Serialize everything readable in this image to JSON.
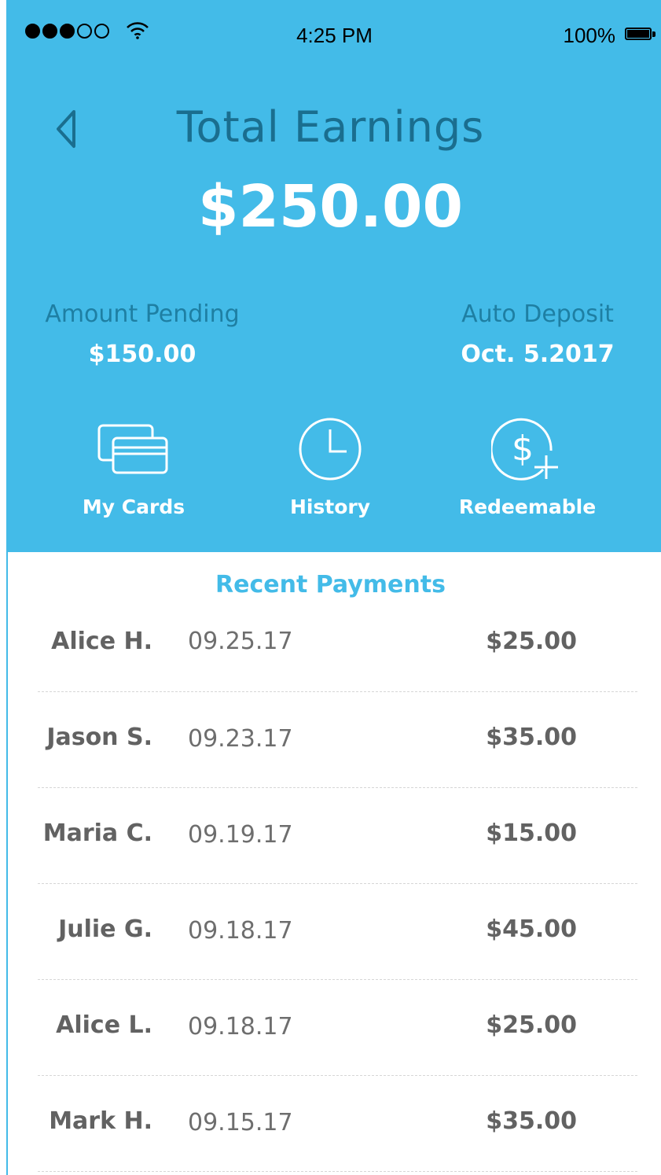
{
  "status_bar": {
    "time": "4:25 PM",
    "battery": "100%",
    "signal_icon": "signal-dots-icon",
    "wifi_icon": "wifi-icon",
    "battery_icon": "battery-icon"
  },
  "header": {
    "back_icon": "back-arrow-icon",
    "title": "Total Earnings",
    "total": "$250.00",
    "pending": {
      "label": "Amount Pending",
      "value": "$150.00"
    },
    "deposit": {
      "label": "Auto Deposit",
      "value": "Oct. 5.2017"
    },
    "actions": [
      {
        "label": "My Cards",
        "icon": "cards-icon"
      },
      {
        "label": "History",
        "icon": "clock-icon"
      },
      {
        "label": "Redeemable",
        "icon": "dollar-plus-icon"
      }
    ]
  },
  "recent": {
    "title": "Recent Payments",
    "payments": [
      {
        "name": "Alice H.",
        "date": "09.25.17",
        "amount": "$25.00"
      },
      {
        "name": "Jason S.",
        "date": "09.23.17",
        "amount": "$35.00"
      },
      {
        "name": "Maria C.",
        "date": "09.19.17",
        "amount": "$15.00"
      },
      {
        "name": "Julie G.",
        "date": "09.18.17",
        "amount": "$45.00"
      },
      {
        "name": "Alice L.",
        "date": "09.18.17",
        "amount": "$25.00"
      },
      {
        "name": "Mark H.",
        "date": "09.15.17",
        "amount": "$35.00"
      }
    ]
  },
  "colors": {
    "header_bg": "#43bbe8",
    "title_text": "#1a6e8f",
    "label_text": "#1e7fa3",
    "accent": "#43bbe8",
    "row_text": "#626262"
  }
}
